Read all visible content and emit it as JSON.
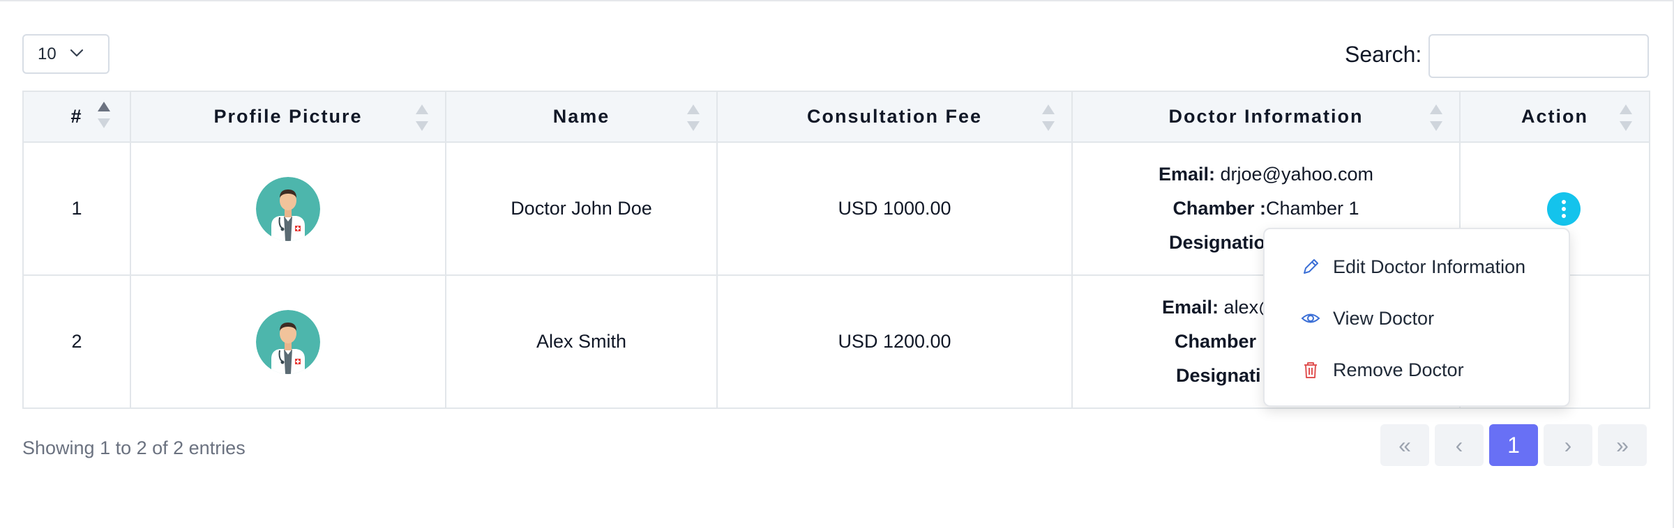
{
  "length": {
    "value": "10"
  },
  "search": {
    "label": "Search:",
    "value": ""
  },
  "table": {
    "columns": [
      "#",
      "Profile Picture",
      "Name",
      "Consultation Fee",
      "Doctor Information",
      "Action"
    ],
    "rows": [
      {
        "num": "1",
        "name": "Doctor John Doe",
        "fee": "USD 1000.00",
        "email_label": "Email:",
        "email": "drjoe@yahoo.com",
        "chamber_label": "Chamber :",
        "chamber": "Chamber 1",
        "designation_label": "Designatio"
      },
      {
        "num": "2",
        "name": "Alex Smith",
        "fee": "USD 1200.00",
        "email_label": "Email:",
        "email": "alex@",
        "chamber_label": "Chamber :",
        "chamber": "",
        "designation_label": "Designati"
      }
    ]
  },
  "menu": {
    "items": [
      {
        "label": "Edit Doctor Information",
        "icon": "pencil-icon"
      },
      {
        "label": "View Doctor",
        "icon": "eye-icon"
      },
      {
        "label": "Remove Doctor",
        "icon": "trash-icon"
      }
    ]
  },
  "footer": {
    "info": "Showing 1 to 2 of 2 entries",
    "pagination": {
      "first": "«",
      "prev": "‹",
      "current": "1",
      "next": "›",
      "last": "»"
    }
  },
  "colors": {
    "accent": "#6870f5",
    "action_button": "#14c3ec",
    "header_bg": "#f3f6f9",
    "avatar_bg": "#4db6ac"
  }
}
